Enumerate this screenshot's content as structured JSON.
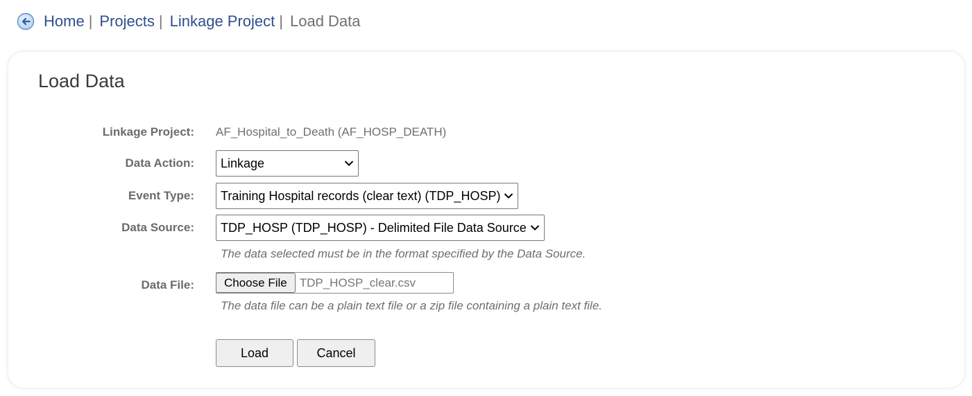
{
  "breadcrumb": {
    "back_icon": "back-arrow-circle-icon",
    "items": [
      {
        "label": "Home"
      },
      {
        "label": "Projects"
      },
      {
        "label": "Linkage Project"
      }
    ],
    "separator": "|",
    "current": "Load Data"
  },
  "panel": {
    "title": "Load Data"
  },
  "form": {
    "linkage_project": {
      "label": "Linkage Project:",
      "value": "AF_Hospital_to_Death (AF_HOSP_DEATH)"
    },
    "data_action": {
      "label": "Data Action:",
      "selected": "Linkage"
    },
    "event_type": {
      "label": "Event Type:",
      "selected": "Training Hospital records (clear text) (TDP_HOSP)"
    },
    "data_source": {
      "label": "Data Source:",
      "selected": "TDP_HOSP (TDP_HOSP) - Delimited File Data Source",
      "hint": "The data selected must be in the format specified by the Data Source."
    },
    "data_file": {
      "label": "Data File:",
      "button_label": "Choose File",
      "file_name": "TDP_HOSP_clear.csv",
      "hint": "The data file can be a plain text file or a zip file containing a plain text file."
    },
    "buttons": {
      "load": "Load",
      "cancel": "Cancel"
    }
  },
  "colors": {
    "link": "#2f4f8f",
    "back_icon": "#4a86c8"
  }
}
